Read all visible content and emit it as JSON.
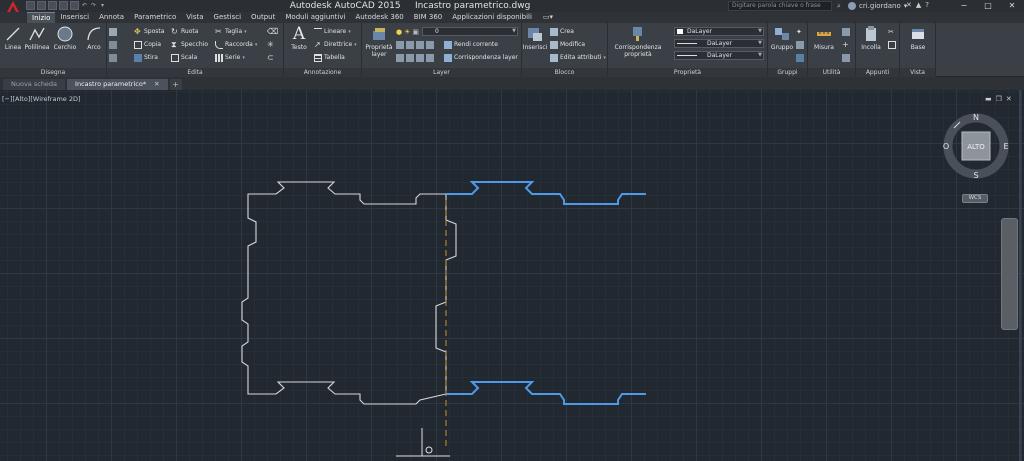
{
  "titlebar": {
    "app_title": "Autodesk AutoCAD 2015",
    "file_name": "Incastro parametrico.dwg",
    "search_placeholder": "Digitare parola chiave o frase",
    "username": "cri.giordano"
  },
  "ribbon_tabs": [
    {
      "label": "Inizio",
      "active": true
    },
    {
      "label": "Inserisci"
    },
    {
      "label": "Annota"
    },
    {
      "label": "Parametrico"
    },
    {
      "label": "Vista"
    },
    {
      "label": "Gestisci"
    },
    {
      "label": "Output"
    },
    {
      "label": "Moduli aggiuntivi"
    },
    {
      "label": "Autodesk 360"
    },
    {
      "label": "BIM 360"
    },
    {
      "label": "Applicazioni disponibili"
    }
  ],
  "panels": {
    "disegna": {
      "title": "Disegna",
      "linea": "Linea",
      "polilinea": "Polilinea",
      "cerchio": "Cerchio",
      "arco": "Arco"
    },
    "edita": {
      "title": "Edita",
      "sposta": "Sposta",
      "ruota": "Ruota",
      "taglia": "Taglia",
      "copia": "Copia",
      "specchio": "Specchio",
      "raccorda": "Raccorda",
      "stira": "Stira",
      "scala": "Scala",
      "serie": "Serie"
    },
    "annotazione": {
      "title": "Annotazione",
      "testo": "Testo",
      "lineare": "Lineare",
      "direttrice": "Direttrice",
      "tabella": "Tabella"
    },
    "layer": {
      "title": "Layer",
      "proprieta_layer": "Proprietà layer",
      "layer_value": "0",
      "rendi_corrente": "Rendi corrente",
      "corrispondenza_layer": "Corrispondenza layer"
    },
    "blocco": {
      "title": "Blocco",
      "inserisci": "Inserisci",
      "crea": "Crea",
      "modifica": "Modifica",
      "edita_attributi": "Edita attributi"
    },
    "proprieta": {
      "title": "Proprietà",
      "corrispondenza": "Corrispondenza proprietà",
      "color": "DaLayer",
      "linetype": "DaLayer",
      "lineweight": "DaLayer"
    },
    "gruppi": {
      "title": "Gruppi",
      "gruppo": "Gruppo"
    },
    "utilita": {
      "title": "Utilità",
      "misura": "Misura"
    },
    "appunti": {
      "title": "Appunti",
      "incolla": "Incolla"
    },
    "vista": {
      "title": "Vista",
      "base": "Base"
    }
  },
  "doc_tabs": [
    {
      "label": "Nuova scheda"
    },
    {
      "label": "Incastro parametrico*",
      "active": true
    }
  ],
  "viewport": {
    "label": "[−][Alto][Wireframe 2D]",
    "viewcube": {
      "north": "N",
      "south": "S",
      "east": "E",
      "west": "O",
      "face": "ALTO"
    },
    "ucs": "WCS"
  },
  "colors": {
    "background": "#212830",
    "selected_geometry": "#4d9be8",
    "geometry": "#d8d8d8",
    "dashed_line": "#c8902e"
  }
}
